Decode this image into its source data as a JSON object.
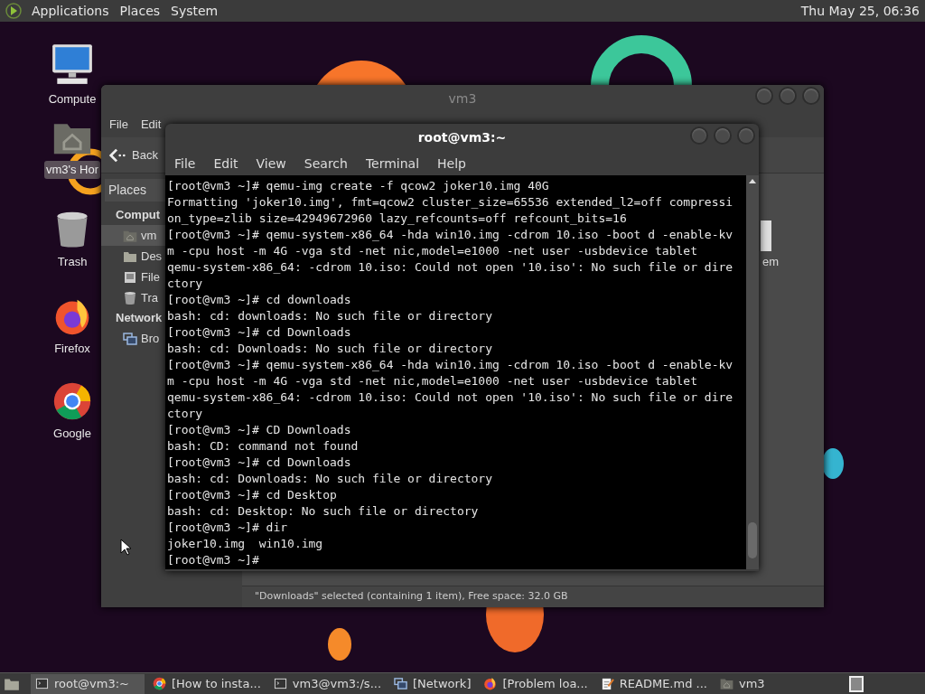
{
  "top_panel": {
    "menus": [
      "Applications",
      "Places",
      "System"
    ],
    "clock": "Thu May 25, 06:36"
  },
  "desktop_icons": [
    {
      "kind": "computer",
      "label": "Compute",
      "selected": false
    },
    {
      "kind": "home",
      "label": "vm3's Hor",
      "selected": true
    },
    {
      "kind": "trash",
      "label": "Trash",
      "selected": false
    },
    {
      "kind": "firefox",
      "label": "Firefox",
      "selected": false
    },
    {
      "kind": "chrome",
      "label": "Google",
      "selected": false
    }
  ],
  "file_manager": {
    "title": "vm3",
    "menus": [
      "File",
      "Edit"
    ],
    "back_label": "Back",
    "places_label": "Places",
    "sidebar": [
      {
        "kind": "heading",
        "label": "Comput"
      },
      {
        "kind": "home",
        "label": "vm",
        "selected": true
      },
      {
        "kind": "desktop",
        "label": "Des",
        "selected": false
      },
      {
        "kind": "filesystem",
        "label": "File",
        "selected": false
      },
      {
        "kind": "trash",
        "label": "Tra",
        "selected": false
      },
      {
        "kind": "heading",
        "label": "Network"
      },
      {
        "kind": "network",
        "label": "Bro",
        "selected": false
      }
    ],
    "file_label": "em",
    "status": "\"Downloads\" selected (containing 1 item), Free space: 32.0 GB"
  },
  "terminal": {
    "title": "root@vm3:~",
    "menus": [
      "File",
      "Edit",
      "View",
      "Search",
      "Terminal",
      "Help"
    ],
    "lines": [
      "[root@vm3 ~]# qemu-img create -f qcow2 joker10.img 40G",
      "Formatting 'joker10.img', fmt=qcow2 cluster_size=65536 extended_l2=off compressi",
      "on_type=zlib size=42949672960 lazy_refcounts=off refcount_bits=16",
      "[root@vm3 ~]# qemu-system-x86_64 -hda win10.img -cdrom 10.iso -boot d -enable-kv",
      "m -cpu host -m 4G -vga std -net nic,model=e1000 -net user -usbdevice tablet",
      "qemu-system-x86_64: -cdrom 10.iso: Could not open '10.iso': No such file or dire",
      "ctory",
      "[root@vm3 ~]# cd downloads",
      "bash: cd: downloads: No such file or directory",
      "[root@vm3 ~]# cd Downloads",
      "bash: cd: Downloads: No such file or directory",
      "[root@vm3 ~]# qemu-system-x86_64 -hda win10.img -cdrom 10.iso -boot d -enable-kv",
      "m -cpu host -m 4G -vga std -net nic,model=e1000 -net user -usbdevice tablet",
      "qemu-system-x86_64: -cdrom 10.iso: Could not open '10.iso': No such file or dire",
      "ctory",
      "[root@vm3 ~]# CD Downloads",
      "bash: CD: command not found",
      "[root@vm3 ~]# cd Downloads",
      "bash: cd: Downloads: No such file or directory",
      "[root@vm3 ~]# cd Desktop",
      "bash: cd: Desktop: No such file or directory",
      "[root@vm3 ~]# dir",
      "joker10.img  win10.img",
      "[root@vm3 ~]#"
    ]
  },
  "taskbar": [
    {
      "kind": "terminal",
      "label": "root@vm3:~",
      "selected": true
    },
    {
      "kind": "chrome",
      "label": "[How to insta...",
      "selected": false
    },
    {
      "kind": "terminal",
      "label": "vm3@vm3:/s...",
      "selected": false
    },
    {
      "kind": "network",
      "label": "[Network]",
      "selected": false
    },
    {
      "kind": "firefox",
      "label": "[Problem loa...",
      "selected": false
    },
    {
      "kind": "editor",
      "label": "README.md ...",
      "selected": false
    },
    {
      "kind": "folder",
      "label": "vm3",
      "selected": false
    }
  ]
}
